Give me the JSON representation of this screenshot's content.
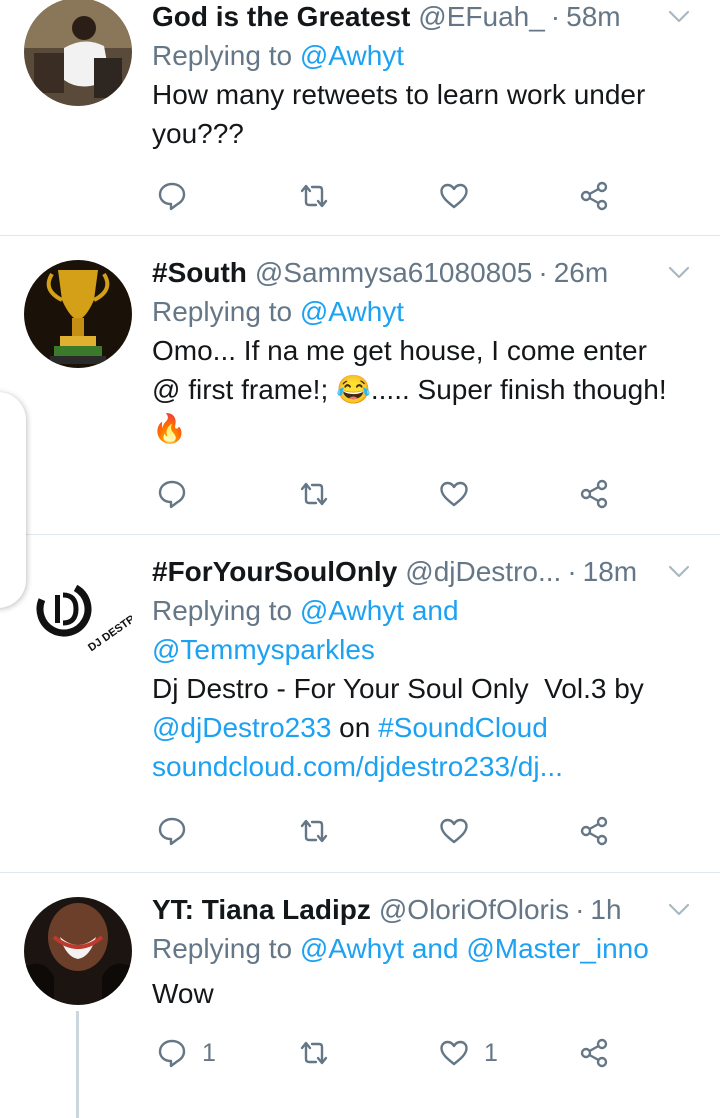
{
  "tweets": [
    {
      "name": "God is the Greatest",
      "handle": "@EFuah_",
      "time": "58m",
      "replying_prefix": "Replying to",
      "replying_to": "@Awhyt",
      "text_lines": [
        "How many retweets to learn work under",
        "you???"
      ],
      "reply_count": "",
      "like_count": ""
    },
    {
      "name": "#South",
      "handle": "@Sammysa61080805",
      "time": "26m",
      "replying_prefix": "Replying to",
      "replying_to": "@Awhyt",
      "text_lines": [
        "Omo... If na me get house, I come enter",
        "@ first frame!; 😂..... Super finish though!",
        "🔥"
      ],
      "reply_count": "",
      "like_count": ""
    },
    {
      "name": "#ForYourSoulOnly",
      "handle": "@djDestro...",
      "time": "18m",
      "replying_prefix": "Replying to",
      "replying_to": "@Awhyt and",
      "replying_to_line2": "@Temmysparkles",
      "text_line1": "Dj Destro - For Your Soul Only  Vol.3 by",
      "text_mention": "@djDestro233",
      "text_on": " on ",
      "text_hashtag": "#SoundCloud",
      "text_url": "soundcloud.com/djdestro233/dj...",
      "avatar_text": "DJ DESTRO",
      "reply_count": "",
      "like_count": ""
    },
    {
      "name": "YT: Tiana Ladipz",
      "handle": "@OloriOfOloris",
      "time": "1h",
      "replying_prefix": "Replying to",
      "replying_to": "@Awhyt and @Master_inno",
      "text_lines": [
        "Wow"
      ],
      "reply_count": "1",
      "like_count": "1"
    }
  ],
  "separator": "·",
  "icons": {
    "reply": "reply-icon",
    "retweet": "retweet-icon",
    "like": "heart-icon",
    "share": "share-icon",
    "caret": "chevron-down-icon"
  },
  "colors": {
    "text": "#14171a",
    "secondary": "#657786",
    "link": "#1da1f2",
    "divider": "#e1e8ed"
  }
}
